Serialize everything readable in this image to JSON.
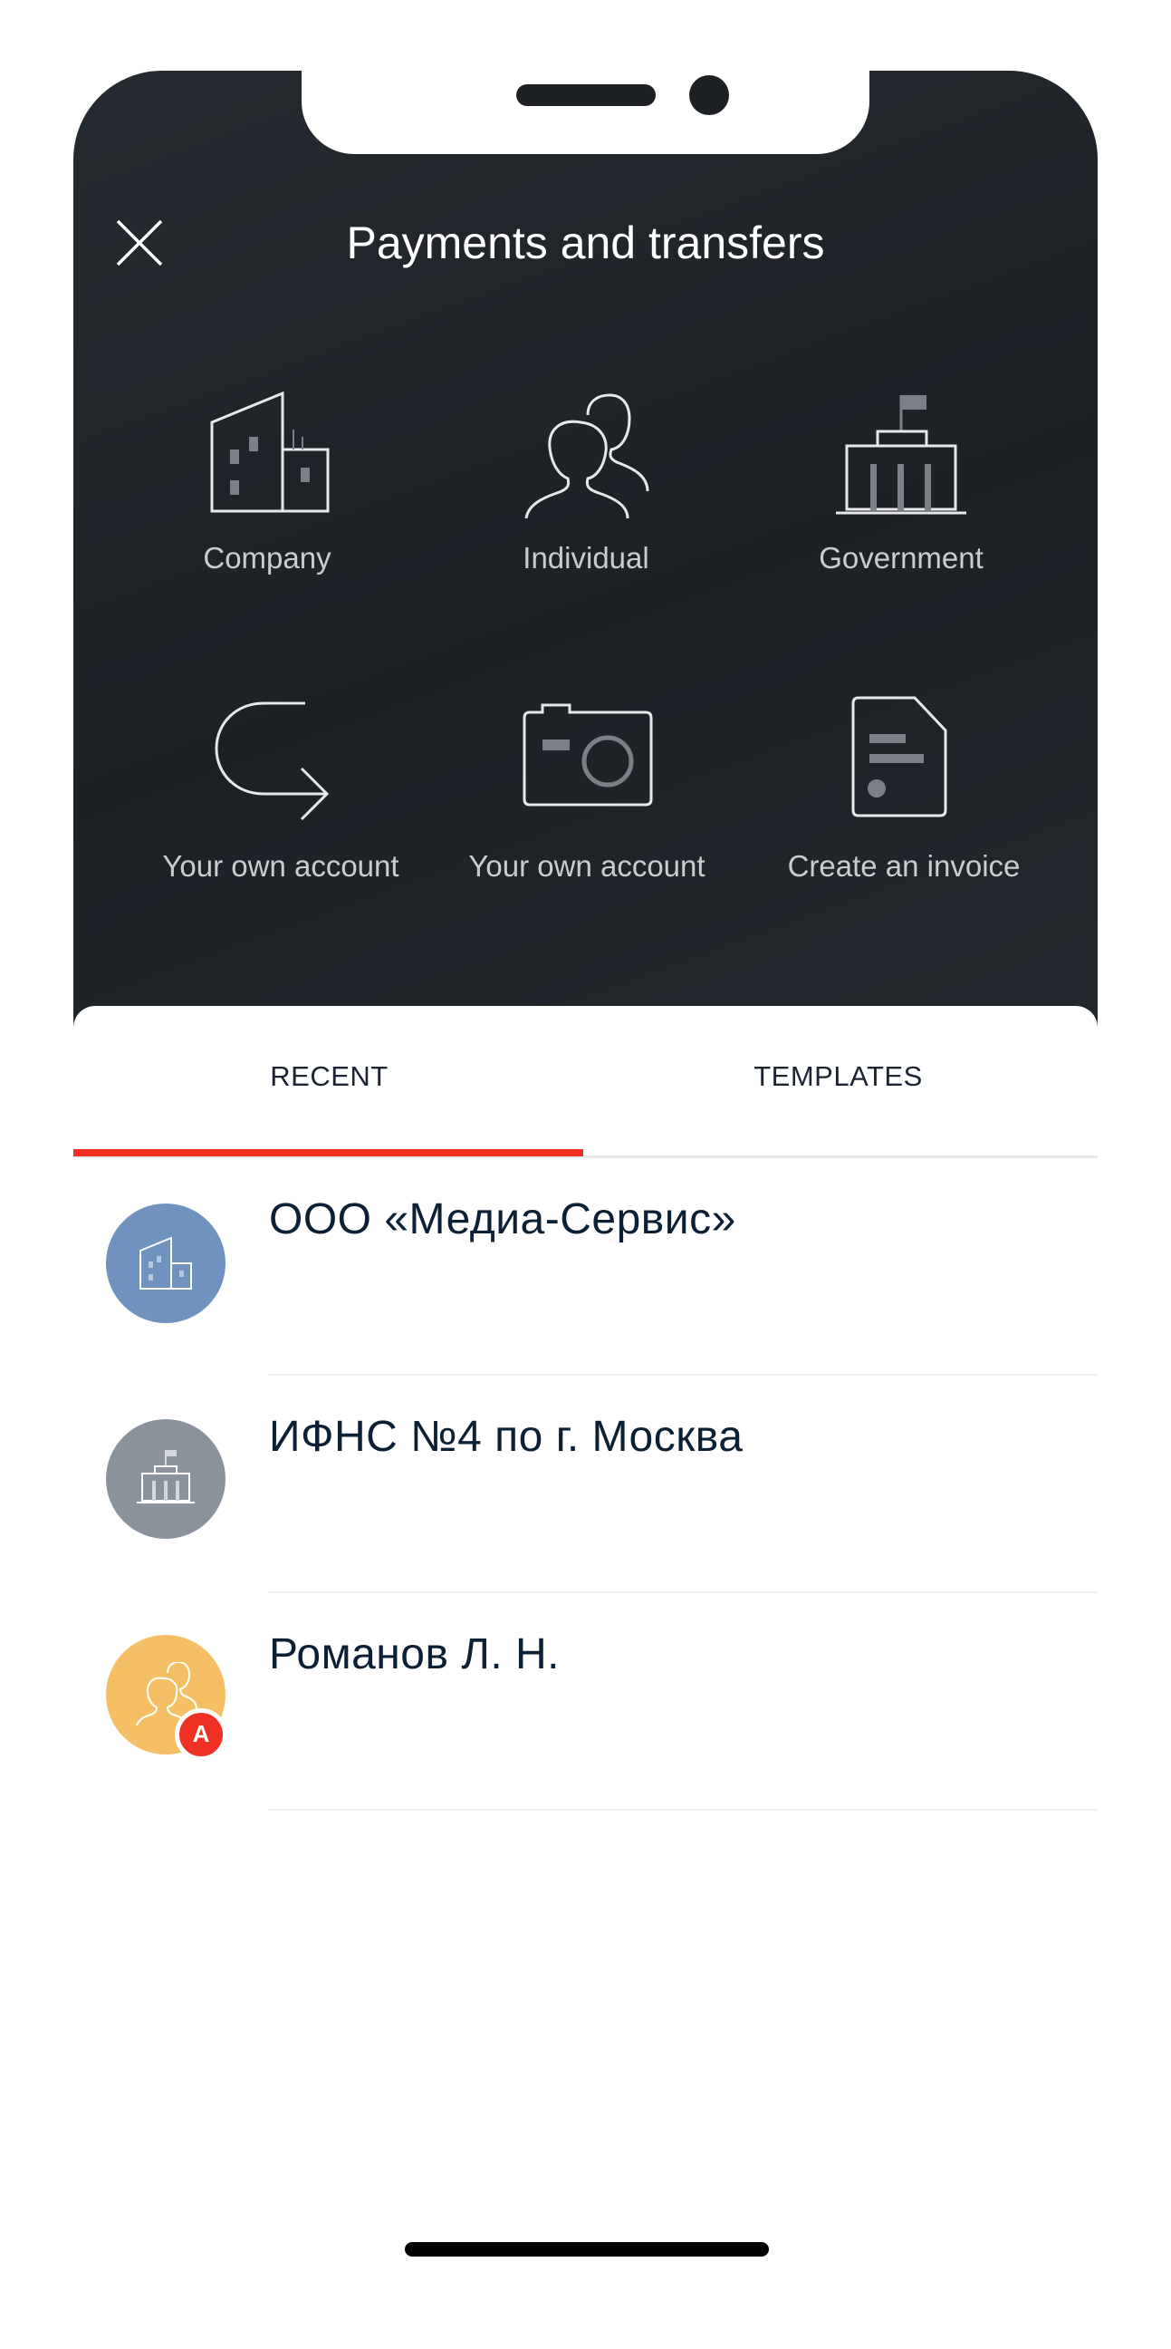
{
  "header": {
    "title": "Payments and transfers"
  },
  "actions": [
    {
      "label": "Company",
      "icon": "building-icon"
    },
    {
      "label": "Individual",
      "icon": "people-icon"
    },
    {
      "label": "Government",
      "icon": "government-building-icon"
    },
    {
      "label": "Your own account",
      "icon": "return-arrow-icon"
    },
    {
      "label": "Your own account",
      "icon": "camera-icon"
    },
    {
      "label": "Create an invoice",
      "icon": "invoice-icon"
    }
  ],
  "tabs": [
    {
      "label": "RECENT",
      "active": true
    },
    {
      "label": "TEMPLATES",
      "active": false
    }
  ],
  "recent": [
    {
      "name": "ООО «Медиа-Сервис»",
      "avatar_color": "#6f93be",
      "icon": "building-icon"
    },
    {
      "name": "ИФНС №4 по г. Москва",
      "avatar_color": "#8a929c",
      "icon": "government-building-icon"
    },
    {
      "name": "Романов Л. Н.",
      "avatar_color": "#f5c065",
      "icon": "people-icon",
      "badge": "A"
    }
  ],
  "colors": {
    "accent": "#ef3124",
    "dark_bg": "#1f2328",
    "text_dark": "#0b1f35"
  }
}
